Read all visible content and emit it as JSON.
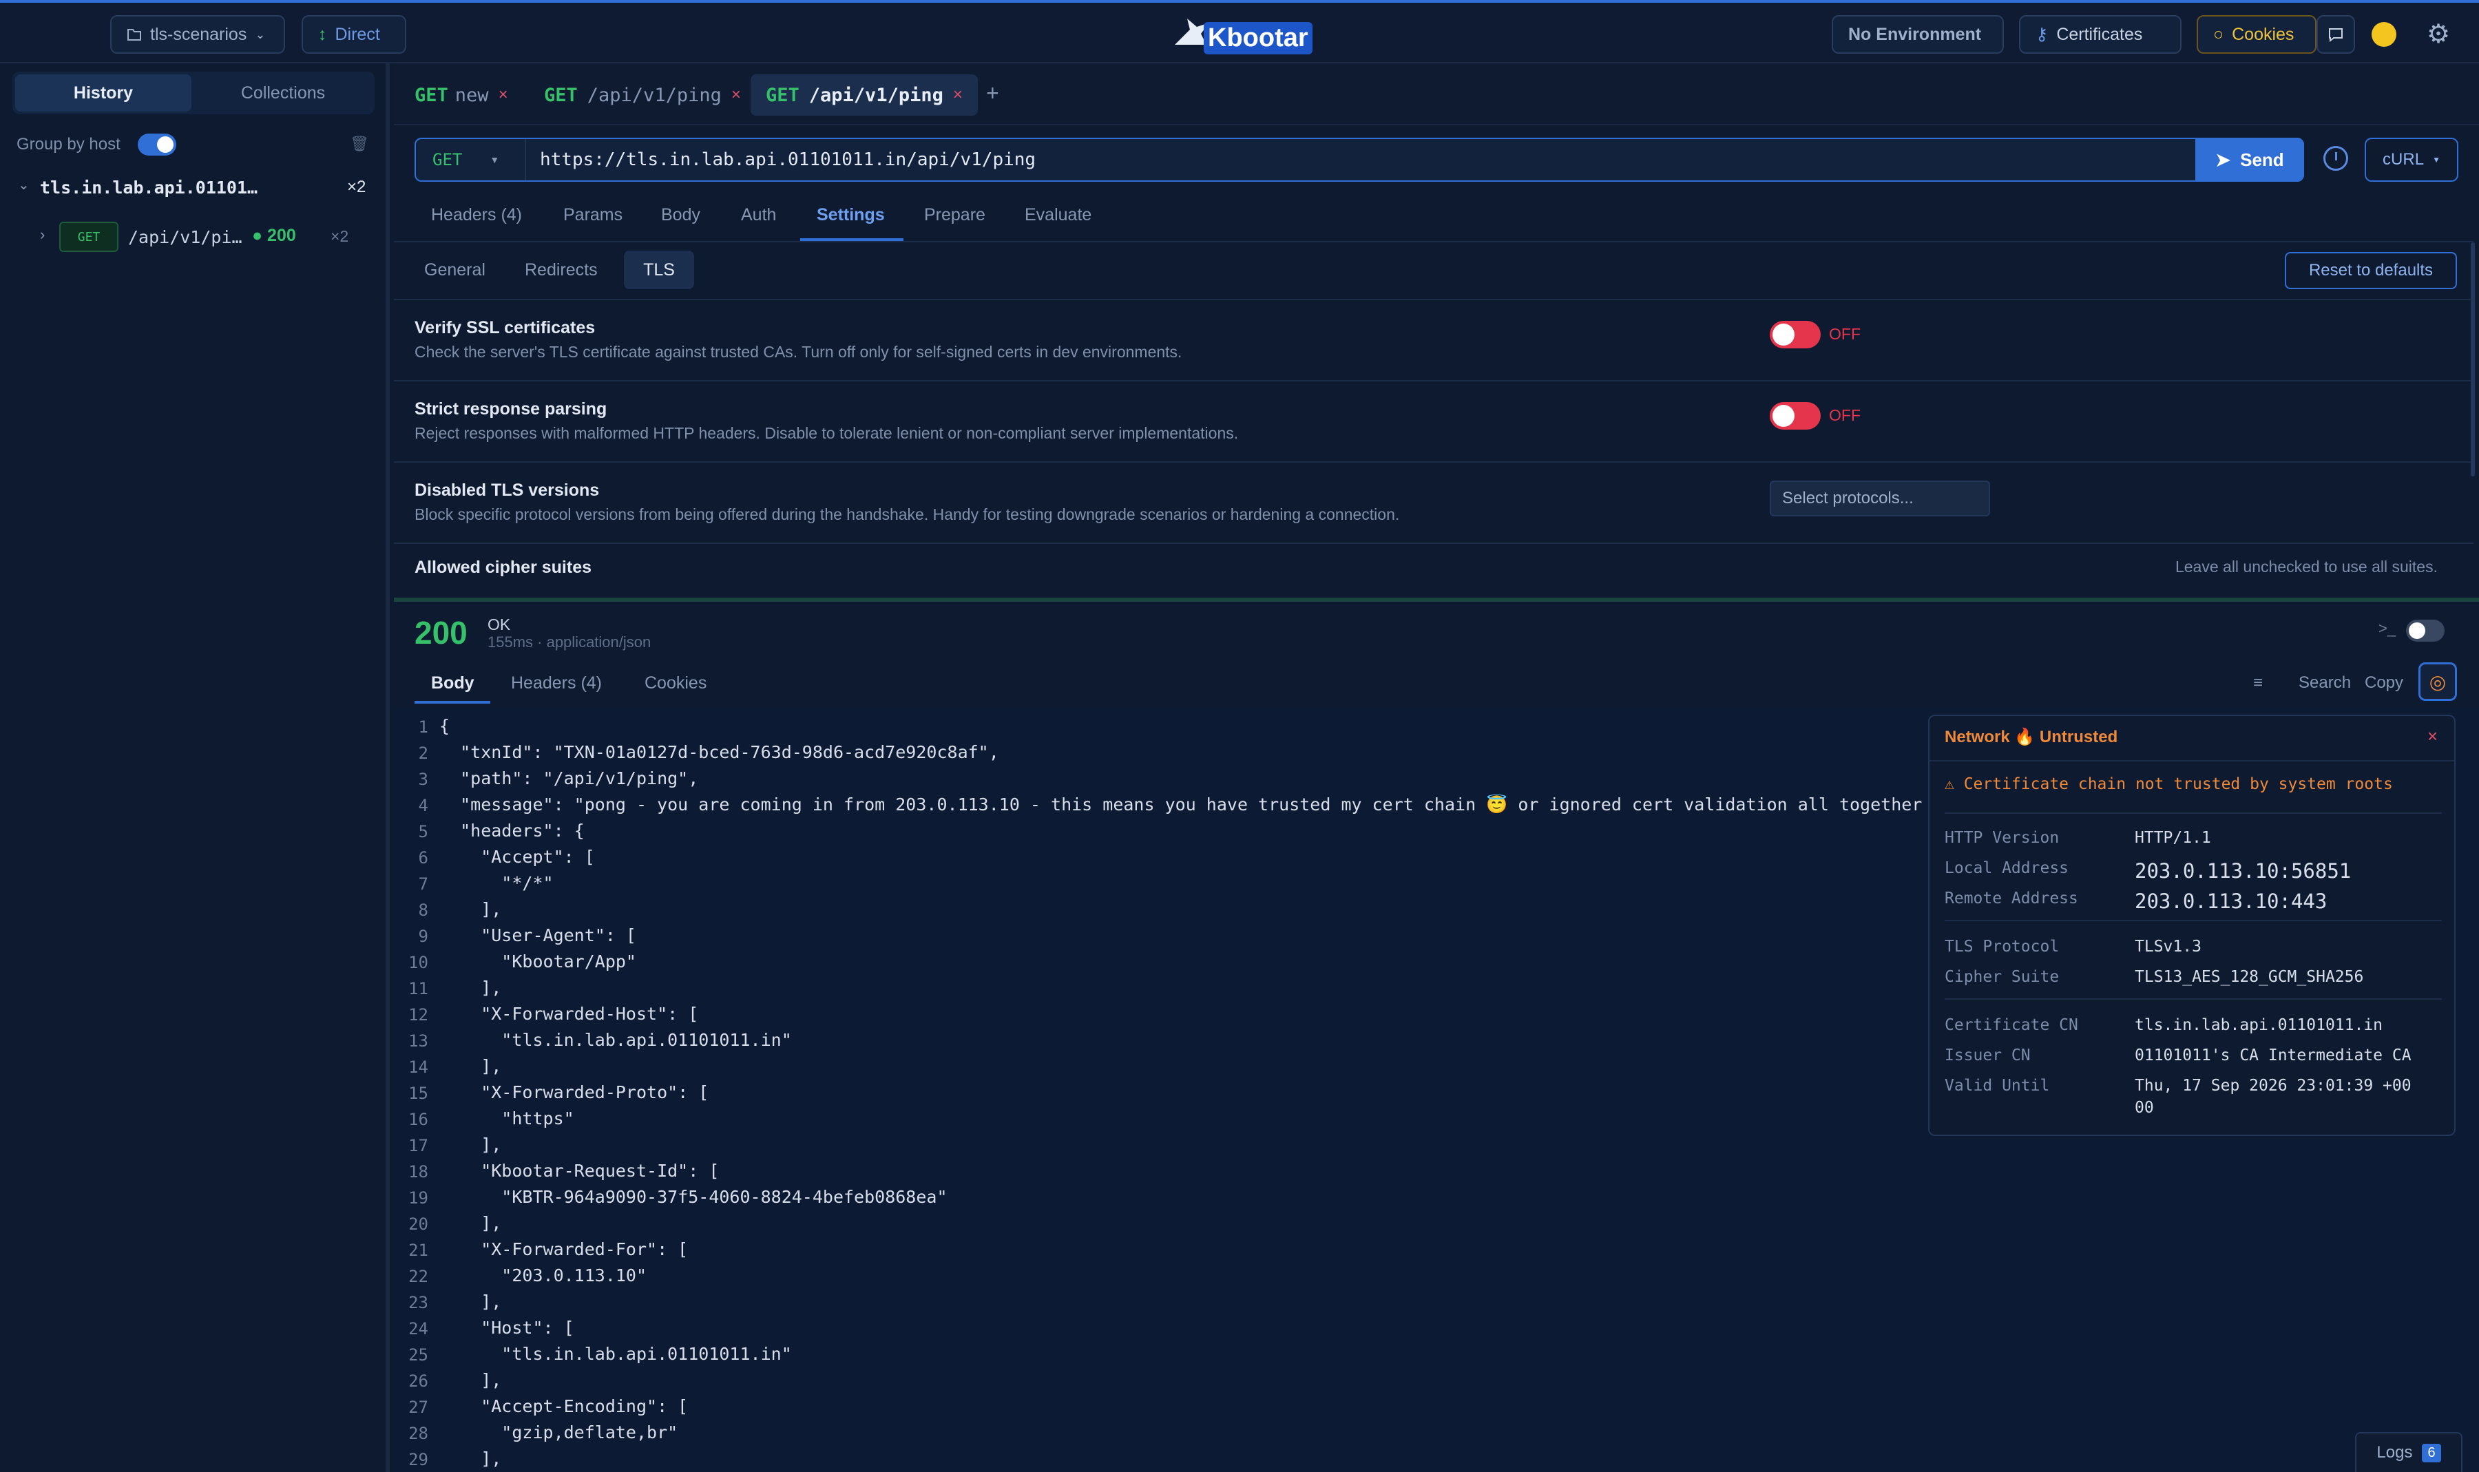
{
  "topbar": {
    "workspace": "tls-scenarios",
    "proxy": "Direct",
    "logo": "Kbootar",
    "environment": "No Environment",
    "certificates": "Certificates",
    "cookies": "Cookies"
  },
  "sidebar": {
    "tabs": [
      "History",
      "Collections"
    ],
    "group_by_host_label": "Group by host",
    "host": "tls.in.lab.api.01101…",
    "host_count": "×2",
    "entry": {
      "method": "GET",
      "path": "/api/v1/pi…",
      "status": "200",
      "count": "×2"
    }
  },
  "request_tabs": [
    {
      "method": "GET",
      "name": "new"
    },
    {
      "method": "GET",
      "name": "/api/v1/ping"
    },
    {
      "method": "GET",
      "name": "/api/v1/ping"
    }
  ],
  "url_bar": {
    "method": "GET",
    "url": "https://tls.in.lab.api.01101011.in/api/v1/ping",
    "send": "Send",
    "export": "cURL"
  },
  "request_section_tabs": [
    "Headers (4)",
    "Params",
    "Body",
    "Auth",
    "Settings",
    "Prepare",
    "Evaluate"
  ],
  "settings_subtabs": [
    "General",
    "Redirects",
    "TLS"
  ],
  "reset_label": "Reset to defaults",
  "settings": {
    "verify_ssl": {
      "title": "Verify SSL certificates",
      "desc": "Check the server's TLS certificate against trusted CAs. Turn off only for self-signed certs in dev environments.",
      "state": "OFF"
    },
    "strict_parsing": {
      "title": "Strict response parsing",
      "desc": "Reject responses with malformed HTTP headers. Disable to tolerate lenient or non-compliant server implementations.",
      "state": "OFF"
    },
    "disabled_tls": {
      "title": "Disabled TLS versions",
      "desc": "Block specific protocol versions from being offered during the handshake. Handy for testing downgrade scenarios or hardening a connection.",
      "placeholder": "Select protocols..."
    },
    "cipher_suites": {
      "title": "Allowed cipher suites",
      "hint": "Leave all unchecked to use all suites."
    }
  },
  "response": {
    "status_code": "200",
    "status_text": "OK",
    "meta": "155ms · application/json",
    "tabs": [
      "Body",
      "Headers (4)",
      "Cookies"
    ],
    "search": "Search",
    "copy": "Copy"
  },
  "body_lines": [
    "{",
    "  \"txnId\": \"TXN-01a0127d-bced-763d-98d6-acd7e920c8af\",",
    "  \"path\": \"/api/v1/ping\",",
    "  \"message\": \"pong - you are coming in from 203.0.113.10 - this means you have trusted my cert chain 😇 or ignored cert validation all together 😉",
    "  \"headers\": {",
    "    \"Accept\": [",
    "      \"*/*\"",
    "    ],",
    "    \"User-Agent\": [",
    "      \"Kbootar/App\"",
    "    ],",
    "    \"X-Forwarded-Host\": [",
    "      \"tls.in.lab.api.01101011.in\"",
    "    ],",
    "    \"X-Forwarded-Proto\": [",
    "      \"https\"",
    "    ],",
    "    \"Kbootar-Request-Id\": [",
    "      \"KBTR-964a9090-37f5-4060-8824-4befeb0868ea\"",
    "    ],",
    "    \"X-Forwarded-For\": [",
    "      \"203.0.113.10\"",
    "    ],",
    "    \"Host\": [",
    "      \"tls.in.lab.api.01101011.in\"",
    "    ],",
    "    \"Accept-Encoding\": [",
    "      \"gzip,deflate,br\"",
    "    ],"
  ],
  "network": {
    "title": "Network",
    "badge": "Untrusted",
    "warning": "⚠ Certificate chain not trusted by system roots",
    "rows": [
      {
        "k": "HTTP Version",
        "v": "HTTP/1.1"
      },
      {
        "k": "Local Address",
        "v": "203.0.113.10:56851"
      },
      {
        "k": "Remote Address",
        "v": "203.0.113.10:443"
      },
      {
        "k": "TLS Protocol",
        "v": "TLSv1.3"
      },
      {
        "k": "Cipher Suite",
        "v": "TLS13_AES_128_GCM_SHA256"
      },
      {
        "k": "Certificate CN",
        "v": "tls.in.lab.api.01101011.in"
      },
      {
        "k": "Issuer CN",
        "v": "01101011's CA Intermediate CA"
      },
      {
        "k": "Valid Until",
        "v": "Thu, 17 Sep 2026 23:01:39 +00"
      },
      {
        "k": "",
        "v": "00"
      }
    ]
  },
  "logs": {
    "label": "Logs",
    "count": "6"
  }
}
